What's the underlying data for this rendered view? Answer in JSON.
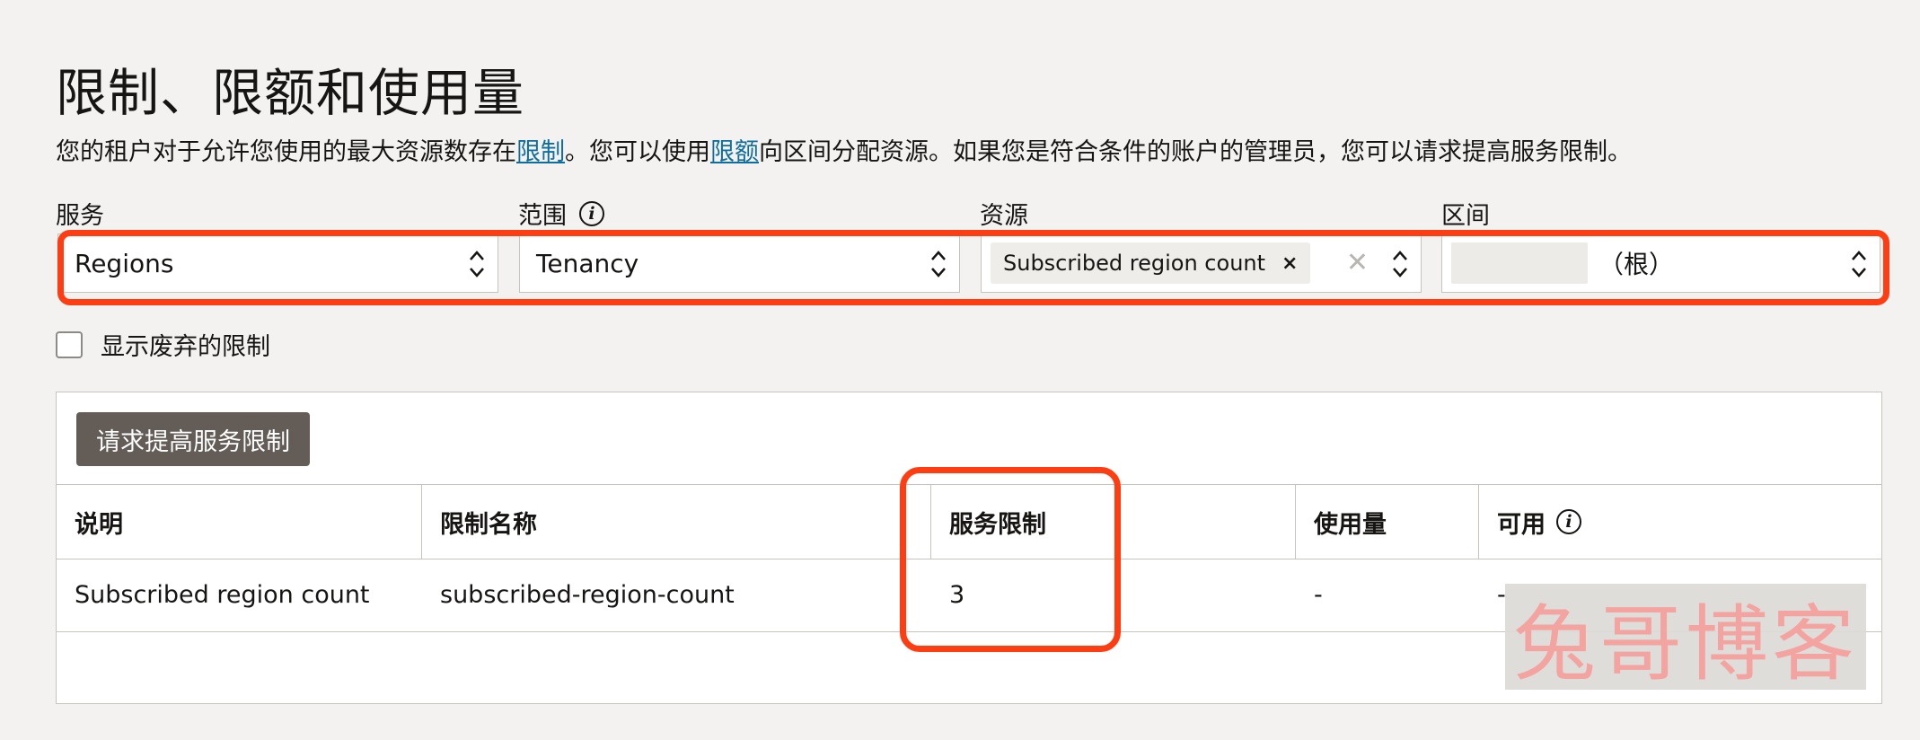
{
  "page": {
    "title": "限制、限额和使用量",
    "description_prefix": "您的租户对于允许您使用的最大资源数存在",
    "description_link1": "限制",
    "description_mid": "。您可以使用",
    "description_link2": "限额",
    "description_suffix": "向区间分配资源。如果您是符合条件的账户的管理员，您可以请求提高服务限制。"
  },
  "filters": {
    "service": {
      "label": "服务",
      "value": "Regions"
    },
    "scope": {
      "label": "范围",
      "value": "Tenancy",
      "info_icon": "info-icon"
    },
    "resource": {
      "label": "资源",
      "chip": "Subscribed region count",
      "chip_remove": "×",
      "clear": "✕"
    },
    "compartment": {
      "label": "区间",
      "value": "（根）"
    }
  },
  "options": {
    "show_deprecated_label": "显示废弃的限制",
    "show_deprecated_checked": false
  },
  "table": {
    "request_button": "请求提高服务限制",
    "headers": [
      "说明",
      "限制名称",
      "服务限制",
      "使用量",
      "可用"
    ],
    "rows": [
      {
        "description": "Subscribed region count",
        "limit_name": "subscribed-region-count",
        "service_limit": "3",
        "usage": "-",
        "available": "-"
      }
    ]
  },
  "watermark": "兔哥博客",
  "colors": {
    "highlight": "#ff3d12",
    "link": "#0f6e9e",
    "button": "#645d57"
  }
}
